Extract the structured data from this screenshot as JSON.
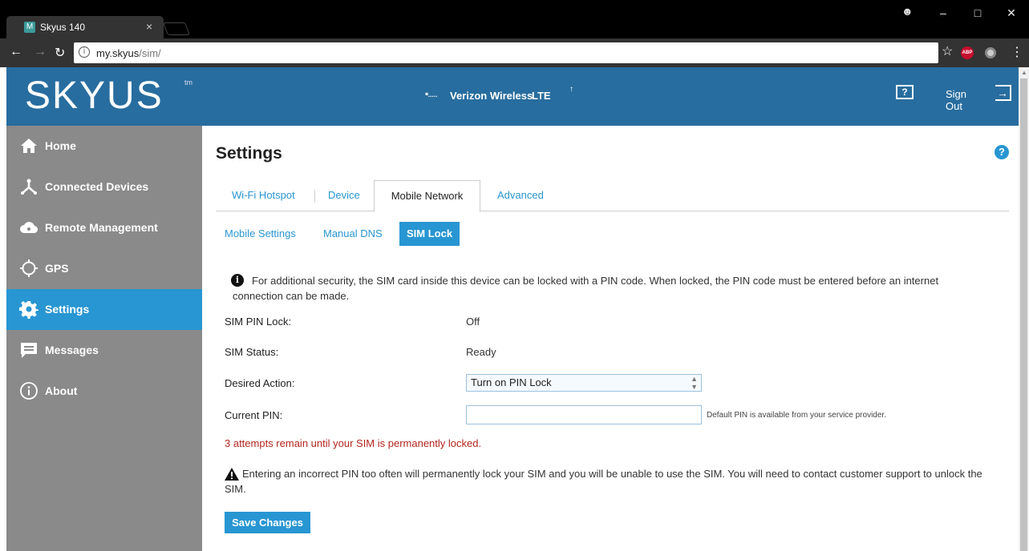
{
  "browser": {
    "tab_title": "Skyus 140",
    "tab_favicon": "M",
    "url_host": "my.skyus",
    "url_path": "/sim/",
    "window_controls": {
      "minimize": "–",
      "maximize": "□",
      "close": "✕"
    },
    "icons": [
      "back-icon",
      "forward-icon",
      "reload-icon",
      "info-icon",
      "star-icon",
      "adblock-icon",
      "extension-icon",
      "menu-icon",
      "user-icon"
    ],
    "abp_label": "ABP"
  },
  "header": {
    "logo": "SKYUS",
    "logo_tm": "tm",
    "signal": "▪.....",
    "carrier": "Verizon Wireless",
    "network": "LTE",
    "help_label": "?",
    "signout_label": "Sign Out",
    "brand_color": "#286d9f"
  },
  "sidebar": {
    "items": [
      {
        "label": "Home",
        "icon": "home-icon",
        "active": false
      },
      {
        "label": "Connected Devices",
        "icon": "connected-devices-icon",
        "active": false
      },
      {
        "label": "Remote Management",
        "icon": "cloud-icon",
        "active": false
      },
      {
        "label": "GPS",
        "icon": "gps-icon",
        "active": false
      },
      {
        "label": "Settings",
        "icon": "gear-icon",
        "active": true
      },
      {
        "label": "Messages",
        "icon": "message-icon",
        "active": false
      },
      {
        "label": "About",
        "icon": "info-icon",
        "active": false
      }
    ],
    "active_color": "#2896d2"
  },
  "main": {
    "title": "Settings",
    "help": "?",
    "tabs": [
      {
        "label": "Wi-Fi Hotspot",
        "active": false
      },
      {
        "label": "Device",
        "active": false
      },
      {
        "label": "Mobile Network",
        "active": true
      },
      {
        "label": "Advanced",
        "active": false
      }
    ],
    "subtabs": [
      {
        "label": "Mobile Settings",
        "active": false
      },
      {
        "label": "Manual DNS",
        "active": false
      },
      {
        "label": "SIM Lock",
        "active": true
      }
    ],
    "info_text": "For additional security, the SIM card inside this device can be locked with a PIN code. When locked, the PIN code must be entered before an internet connection can be made.",
    "fields": {
      "sim_pin_lock_label": "SIM PIN Lock:",
      "sim_pin_lock_value": "Off",
      "sim_status_label": "SIM Status:",
      "sim_status_value": "Ready",
      "desired_action_label": "Desired Action:",
      "desired_action_value": "Turn on PIN Lock",
      "current_pin_label": "Current PIN:",
      "current_pin_value": "",
      "pin_hint": "Default PIN is available from your service provider."
    },
    "attempts_text": "3 attempts remain until your SIM is permanently locked.",
    "warning_text": "Entering an incorrect PIN too often will permanently lock your SIM and you will be unable to use the SIM. You will need to contact customer support to unlock the SIM.",
    "save_label": "Save Changes",
    "error_color": "#b3261e"
  }
}
